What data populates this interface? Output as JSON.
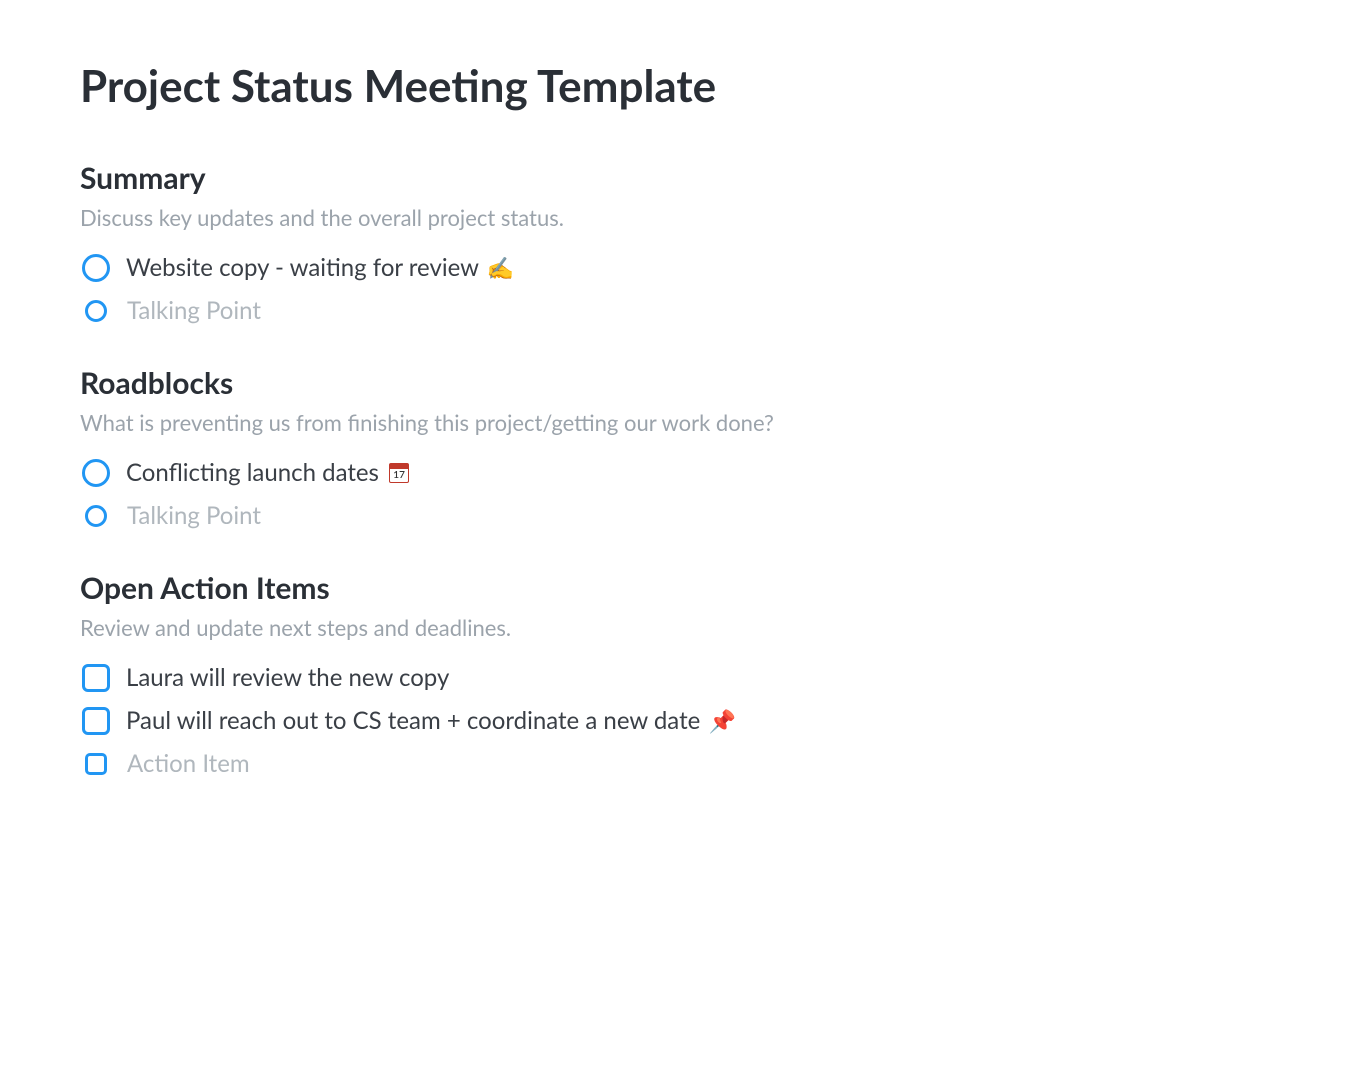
{
  "title": "Project Status Meeting Template",
  "sections": {
    "summary": {
      "heading": "Summary",
      "description": "Discuss key updates and the overall project status.",
      "items": [
        {
          "text": "Website copy - waiting for review",
          "emoji": "✍️"
        }
      ],
      "placeholder": "Talking Point"
    },
    "roadblocks": {
      "heading": "Roadblocks",
      "description": "What is preventing us from finishing this project/getting our work done?",
      "items": [
        {
          "text": "Conflicting launch dates",
          "calendar": "17"
        }
      ],
      "placeholder": "Talking Point"
    },
    "actions": {
      "heading": "Open Action Items",
      "description": "Review and update next steps and deadlines.",
      "items": [
        {
          "text": "Laura will review the new copy"
        },
        {
          "text": "Paul will reach out to CS team + coordinate a new date",
          "emoji": "📌"
        }
      ],
      "placeholder": "Action Item"
    }
  }
}
